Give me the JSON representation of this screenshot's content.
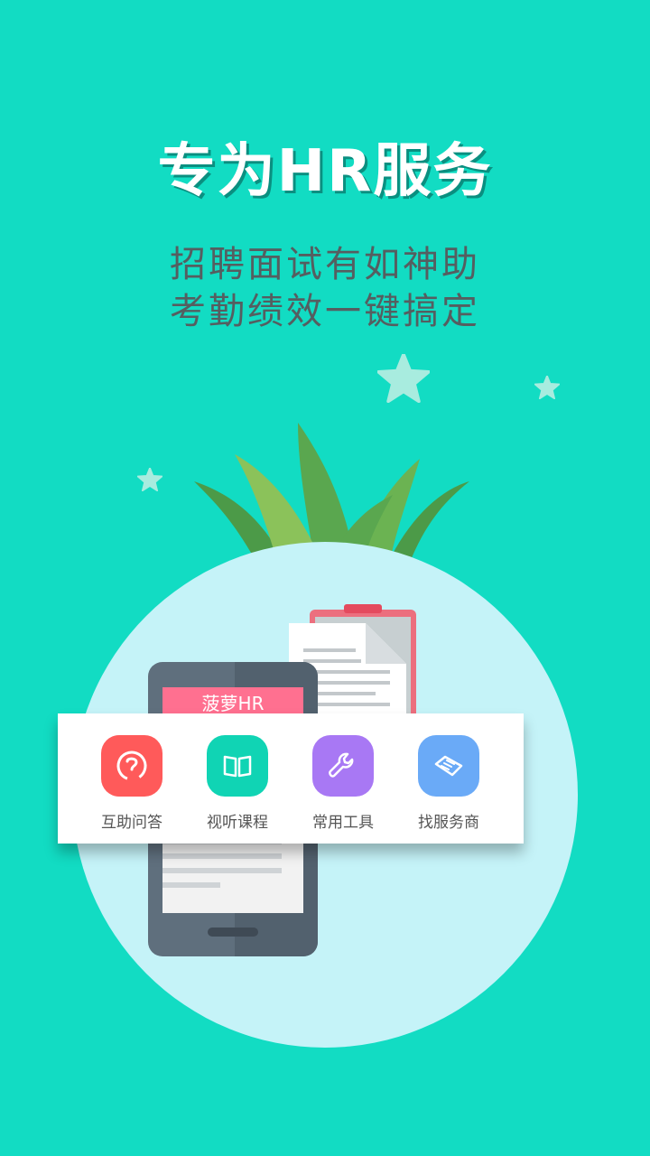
{
  "hero": {
    "title": "专为HR服务",
    "subtitle_line1": "招聘面试有如神助",
    "subtitle_line2": "考勤绩效一键搞定"
  },
  "phone": {
    "banner_text": "菠萝HR"
  },
  "features": [
    {
      "label": "互助问答",
      "icon": "help-circle-icon",
      "color": "#ff5a5a"
    },
    {
      "label": "视听课程",
      "icon": "book-icon",
      "color": "#10d4b4"
    },
    {
      "label": "常用工具",
      "icon": "wrench-icon",
      "color": "#a878f4"
    },
    {
      "label": "找服务商",
      "icon": "handshake-icon",
      "color": "#6aaaf7"
    }
  ],
  "colors": {
    "background": "#12dcc3",
    "circle": "#c5f3f8",
    "title_shadow": "#0a8f80",
    "subtitle": "#555e60"
  }
}
